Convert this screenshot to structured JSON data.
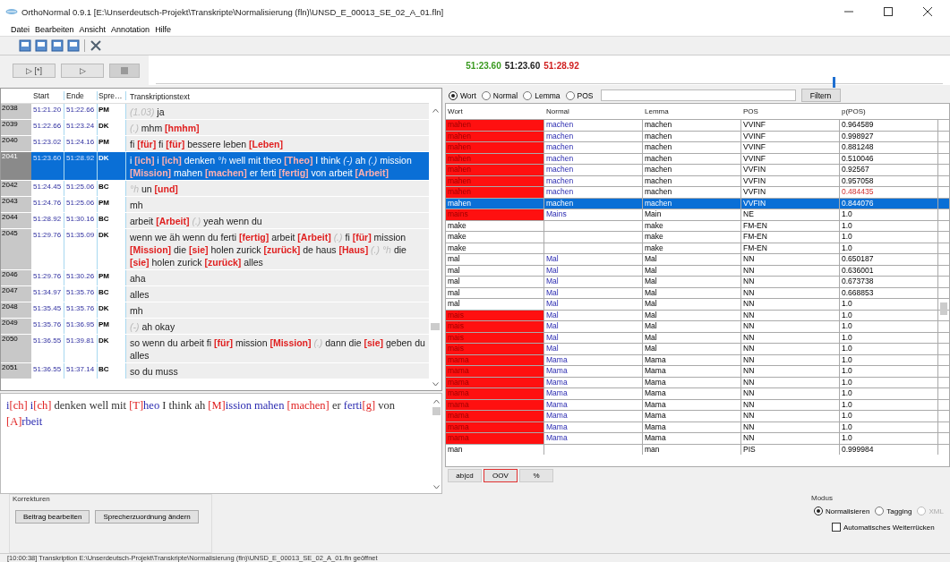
{
  "window": {
    "title": "OrthoNormal 0.9.1 [E:\\Unserdeutsch-Projekt\\Transkripte\\Normalisierung (fln)\\UNSD_E_00013_SE_02_A_01.fln]"
  },
  "menu": [
    "Datei",
    "Bearbeiten",
    "Ansicht",
    "Annotation",
    "Hilfe"
  ],
  "player": {
    "buttons": [
      {
        "label": "▷ [*]",
        "disabled": false
      },
      {
        "label": "▷",
        "disabled": false
      },
      {
        "kind": "stop",
        "disabled": true
      }
    ],
    "times": [
      {
        "text": "51:23.60",
        "color": "#3a9a20"
      },
      {
        "text": "51:23.60",
        "color": "#202020"
      },
      {
        "text": "51:28.92",
        "color": "#d02020"
      }
    ],
    "level": 0.86
  },
  "transcript": {
    "columns": [
      "Start",
      "Ende",
      "Spre…",
      "Transkriptionstext"
    ],
    "rows": [
      {
        "num": "2038",
        "start": "51:21.20",
        "end": "51:22.66",
        "speaker": "PM",
        "selected": false,
        "text": [
          {
            "t": "(1.03)",
            "kind": "pause"
          },
          {
            "t": "ja",
            "kind": "plain"
          }
        ]
      },
      {
        "num": "2039",
        "start": "51:22.66",
        "end": "51:23.24",
        "speaker": "DK",
        "selected": false,
        "text": [
          {
            "t": "(.)",
            "kind": "pause"
          },
          {
            "t": "mhm",
            "kind": "plain"
          },
          {
            "t": "[hmhm]",
            "kind": "norm"
          }
        ]
      },
      {
        "num": "2040",
        "start": "51:23.02",
        "end": "51:24.16",
        "speaker": "PM",
        "selected": false,
        "text": [
          {
            "t": "fi",
            "kind": "plain"
          },
          {
            "t": "[für]",
            "kind": "norm"
          },
          {
            "t": "fi",
            "kind": "plain"
          },
          {
            "t": "[für]",
            "kind": "norm"
          },
          {
            "t": "bessere leben",
            "kind": "plain"
          },
          {
            "t": "[Leben]",
            "kind": "norm"
          }
        ]
      },
      {
        "num": "2041",
        "start": "51:23.60",
        "end": "51:28.92",
        "speaker": "DK",
        "selected": true,
        "text": [
          {
            "t": "i",
            "kind": "plain"
          },
          {
            "t": "[ich]",
            "kind": "norm"
          },
          {
            "t": "i",
            "kind": "plain"
          },
          {
            "t": "[ich]",
            "kind": "norm"
          },
          {
            "t": "denken",
            "kind": "plain"
          },
          {
            "t": "°h",
            "kind": "pause"
          },
          {
            "t": "well mit theo",
            "kind": "plain"
          },
          {
            "t": "[Theo]",
            "kind": "norm"
          },
          {
            "t": "I think",
            "kind": "plain"
          },
          {
            "t": "(-)",
            "kind": "pause"
          },
          {
            "t": "ah",
            "kind": "plain"
          },
          {
            "t": "(.)",
            "kind": "pause"
          },
          {
            "t": "mission",
            "kind": "plain"
          },
          {
            "t": "[Mission]",
            "kind": "norm"
          },
          {
            "t": "mahen",
            "kind": "plain"
          },
          {
            "t": "[machen]",
            "kind": "norm"
          },
          {
            "t": "er ferti",
            "kind": "plain"
          },
          {
            "t": "[fertig]",
            "kind": "norm"
          },
          {
            "t": "von arbeit",
            "kind": "plain"
          },
          {
            "t": "[Arbeit]",
            "kind": "norm"
          }
        ]
      },
      {
        "num": "2042",
        "start": "51:24.45",
        "end": "51:25.06",
        "speaker": "BC",
        "selected": false,
        "text": [
          {
            "t": "°h",
            "kind": "pause"
          },
          {
            "t": "un",
            "kind": "plain"
          },
          {
            "t": "[und]",
            "kind": "norm"
          }
        ]
      },
      {
        "num": "2043",
        "start": "51:24.76",
        "end": "51:25.06",
        "speaker": "PM",
        "selected": false,
        "text": [
          {
            "t": "mh",
            "kind": "plain"
          }
        ]
      },
      {
        "num": "2044",
        "start": "51:28.92",
        "end": "51:30.16",
        "speaker": "BC",
        "selected": false,
        "text": [
          {
            "t": "arbeit",
            "kind": "plain"
          },
          {
            "t": "[Arbeit]",
            "kind": "norm"
          },
          {
            "t": "(.)",
            "kind": "pause"
          },
          {
            "t": "yeah wenn du",
            "kind": "plain"
          }
        ]
      },
      {
        "num": "2045",
        "start": "51:29.76",
        "end": "51:35.09",
        "speaker": "DK",
        "selected": false,
        "text": [
          {
            "t": "wenn we äh wenn du ferti",
            "kind": "plain"
          },
          {
            "t": "[fertig]",
            "kind": "norm"
          },
          {
            "t": "arbeit",
            "kind": "plain"
          },
          {
            "t": "[Arbeit]",
            "kind": "norm"
          },
          {
            "t": "(.)",
            "kind": "pause"
          },
          {
            "t": "fi",
            "kind": "plain"
          },
          {
            "t": "[für]",
            "kind": "norm"
          },
          {
            "t": "mission",
            "kind": "plain"
          },
          {
            "t": "[Mission]",
            "kind": "norm"
          },
          {
            "t": "die",
            "kind": "plain"
          },
          {
            "t": "[sie]",
            "kind": "norm"
          },
          {
            "t": "holen zurick",
            "kind": "plain"
          },
          {
            "t": "[zurück]",
            "kind": "norm"
          },
          {
            "t": "de haus",
            "kind": "plain"
          },
          {
            "t": "[Haus]",
            "kind": "norm"
          },
          {
            "t": "(.)",
            "kind": "pause"
          },
          {
            "t": "°h",
            "kind": "pause"
          },
          {
            "t": "die",
            "kind": "plain"
          },
          {
            "t": "[sie]",
            "kind": "norm"
          },
          {
            "t": "holen zurick",
            "kind": "plain"
          },
          {
            "t": "[zurück]",
            "kind": "norm"
          },
          {
            "t": "alles",
            "kind": "plain"
          }
        ]
      },
      {
        "num": "2046",
        "start": "51:29.76",
        "end": "51:30.26",
        "speaker": "PM",
        "selected": false,
        "text": [
          {
            "t": "aha",
            "kind": "plain"
          }
        ]
      },
      {
        "num": "2047",
        "start": "51:34.97",
        "end": "51:35.76",
        "speaker": "BC",
        "selected": false,
        "text": [
          {
            "t": "alles",
            "kind": "plain"
          }
        ]
      },
      {
        "num": "2048",
        "start": "51:35.45",
        "end": "51:35.76",
        "speaker": "DK",
        "selected": false,
        "text": [
          {
            "t": "mh",
            "kind": "plain"
          }
        ]
      },
      {
        "num": "2049",
        "start": "51:35.76",
        "end": "51:36.95",
        "speaker": "PM",
        "selected": false,
        "text": [
          {
            "t": "(-)",
            "kind": "pause"
          },
          {
            "t": "ah okay",
            "kind": "plain"
          }
        ]
      },
      {
        "num": "2050",
        "start": "51:36.55",
        "end": "51:39.81",
        "speaker": "DK",
        "selected": false,
        "text": [
          {
            "t": "so wenn du arbeit fi",
            "kind": "plain"
          },
          {
            "t": "[für]",
            "kind": "norm"
          },
          {
            "t": "mission",
            "kind": "plain"
          },
          {
            "t": "[Mission]",
            "kind": "norm"
          },
          {
            "t": "(.)",
            "kind": "pause"
          },
          {
            "t": "dann die",
            "kind": "plain"
          },
          {
            "t": "[sie]",
            "kind": "norm"
          },
          {
            "t": "geben du alles",
            "kind": "plain"
          }
        ]
      },
      {
        "num": "2051",
        "start": "51:36.55",
        "end": "51:37.14",
        "speaker": "BC",
        "selected": false,
        "text": [
          {
            "t": "so du muss",
            "kind": "plain"
          }
        ]
      }
    ]
  },
  "editor": [
    {
      "t": "i",
      "kind": "word"
    },
    {
      "t": "[ch] ",
      "kind": "fix"
    },
    {
      "t": "i",
      "kind": "word"
    },
    {
      "t": "[ch]",
      "kind": "fix"
    },
    {
      "t": " denken well mit ",
      "kind": "plain"
    },
    {
      "t": "[T]",
      "kind": "fix"
    },
    {
      "t": "heo",
      "kind": "word"
    },
    {
      "t": " I think ah ",
      "kind": "plain"
    },
    {
      "t": "[M]",
      "kind": "fix"
    },
    {
      "t": "ission mahen ",
      "kind": "word"
    },
    {
      "t": "[machen]",
      "kind": "fix"
    },
    {
      "t": " er ",
      "kind": "plain"
    },
    {
      "t": "ferti",
      "kind": "word"
    },
    {
      "t": "[g]",
      "kind": "fix"
    },
    {
      "t": " von ",
      "kind": "plain"
    },
    {
      "t": "[A]",
      "kind": "fix"
    },
    {
      "t": "rbeit",
      "kind": "word"
    }
  ],
  "filter": {
    "options": [
      {
        "label": "Wort",
        "selected": true
      },
      {
        "label": "Normal",
        "selected": false
      },
      {
        "label": "Lemma",
        "selected": false
      },
      {
        "label": "POS",
        "selected": false
      }
    ],
    "button": "Filtern"
  },
  "tokens": {
    "columns": [
      "Wort",
      "Normal",
      "Lemma",
      "POS",
      "p(POS)"
    ],
    "rows": [
      {
        "wort": "mahen",
        "normal": "machen",
        "lemma": "machen",
        "pos": "VVINF",
        "p": "0.964589",
        "oov": true,
        "low": false,
        "selected": false
      },
      {
        "wort": "mahen",
        "normal": "machen",
        "lemma": "machen",
        "pos": "VVINF",
        "p": "0.998927",
        "oov": true,
        "low": false,
        "selected": false
      },
      {
        "wort": "mahen",
        "normal": "machen",
        "lemma": "machen",
        "pos": "VVINF",
        "p": "0.881248",
        "oov": true,
        "low": false,
        "selected": false
      },
      {
        "wort": "mahen",
        "normal": "machen",
        "lemma": "machen",
        "pos": "VVINF",
        "p": "0.510046",
        "oov": true,
        "low": false,
        "selected": false
      },
      {
        "wort": "mahen",
        "normal": "machen",
        "lemma": "machen",
        "pos": "VVFIN",
        "p": "0.92567",
        "oov": true,
        "low": false,
        "selected": false
      },
      {
        "wort": "mahen",
        "normal": "machen",
        "lemma": "machen",
        "pos": "VVFIN",
        "p": "0.957058",
        "oov": true,
        "low": false,
        "selected": false
      },
      {
        "wort": "mahen",
        "normal": "machen",
        "lemma": "machen",
        "pos": "VVFIN",
        "p": "0.484435",
        "oov": true,
        "low": true,
        "selected": false
      },
      {
        "wort": "mahen",
        "normal": "machen",
        "lemma": "machen",
        "pos": "VVFIN",
        "p": "0.844076",
        "oov": true,
        "low": false,
        "selected": true
      },
      {
        "wort": "mains",
        "normal": "Mains",
        "lemma": "Main",
        "pos": "NE",
        "p": "1.0",
        "oov": true,
        "low": false,
        "selected": false
      },
      {
        "wort": "make",
        "lemma": "make",
        "pos": "FM-EN",
        "p": "1.0",
        "oov": false,
        "low": false,
        "selected": false
      },
      {
        "wort": "make",
        "lemma": "make",
        "pos": "FM-EN",
        "p": "1.0",
        "oov": false,
        "low": false,
        "selected": false
      },
      {
        "wort": "make",
        "lemma": "make",
        "pos": "FM-EN",
        "p": "1.0",
        "oov": false,
        "low": false,
        "selected": false
      },
      {
        "wort": "mal",
        "normal": "Mal",
        "lemma": "Mal",
        "pos": "NN",
        "p": "0.650187",
        "oov": false,
        "low": false,
        "selected": false
      },
      {
        "wort": "mal",
        "normal": "Mal",
        "lemma": "Mal",
        "pos": "NN",
        "p": "0.636001",
        "oov": false,
        "low": false,
        "selected": false
      },
      {
        "wort": "mal",
        "normal": "Mal",
        "lemma": "Mal",
        "pos": "NN",
        "p": "0.673738",
        "oov": false,
        "low": false,
        "selected": false
      },
      {
        "wort": "mal",
        "normal": "Mal",
        "lemma": "Mal",
        "pos": "NN",
        "p": "0.668853",
        "oov": false,
        "low": false,
        "selected": false
      },
      {
        "wort": "mal",
        "normal": "Mal",
        "lemma": "Mal",
        "pos": "NN",
        "p": "1.0",
        "oov": false,
        "low": false,
        "selected": false
      },
      {
        "wort": "mais",
        "normal": "Mal",
        "lemma": "Mal",
        "pos": "NN",
        "p": "1.0",
        "oov": true,
        "low": false,
        "selected": false
      },
      {
        "wort": "mais",
        "normal": "Mal",
        "lemma": "Mal",
        "pos": "NN",
        "p": "1.0",
        "oov": true,
        "low": false,
        "selected": false
      },
      {
        "wort": "mais",
        "normal": "Mal",
        "lemma": "Mal",
        "pos": "NN",
        "p": "1.0",
        "oov": true,
        "low": false,
        "selected": false
      },
      {
        "wort": "mais",
        "normal": "Mal",
        "lemma": "Mal",
        "pos": "NN",
        "p": "1.0",
        "oov": true,
        "low": false,
        "selected": false
      },
      {
        "wort": "mama",
        "normal": "Mama",
        "lemma": "Mama",
        "pos": "NN",
        "p": "1.0",
        "oov": true,
        "low": false,
        "selected": false
      },
      {
        "wort": "mama",
        "normal": "Mama",
        "lemma": "Mama",
        "pos": "NN",
        "p": "1.0",
        "oov": true,
        "low": false,
        "selected": false
      },
      {
        "wort": "mama",
        "normal": "Mama",
        "lemma": "Mama",
        "pos": "NN",
        "p": "1.0",
        "oov": true,
        "low": false,
        "selected": false
      },
      {
        "wort": "mama",
        "normal": "Mama",
        "lemma": "Mama",
        "pos": "NN",
        "p": "1.0",
        "oov": true,
        "low": false,
        "selected": false
      },
      {
        "wort": "mama",
        "normal": "Mama",
        "lemma": "Mama",
        "pos": "NN",
        "p": "1.0",
        "oov": true,
        "low": false,
        "selected": false
      },
      {
        "wort": "mama",
        "normal": "Mama",
        "lemma": "Mama",
        "pos": "NN",
        "p": "1.0",
        "oov": true,
        "low": false,
        "selected": false
      },
      {
        "wort": "mama",
        "normal": "Mama",
        "lemma": "Mama",
        "pos": "NN",
        "p": "1.0",
        "oov": true,
        "low": false,
        "selected": false
      },
      {
        "wort": "mama",
        "normal": "Mama",
        "lemma": "Mama",
        "pos": "NN",
        "p": "1.0",
        "oov": true,
        "low": false,
        "selected": false
      },
      {
        "wort": "man",
        "lemma": "man",
        "pos": "PIS",
        "p": "0.999984",
        "oov": false,
        "low": false,
        "selected": false
      }
    ]
  },
  "view_tabs": [
    {
      "label": "ab|cd",
      "selected": false
    },
    {
      "label": "OOV",
      "selected": true
    },
    {
      "label": "%",
      "selected": false
    }
  ],
  "corrections": {
    "title": "Korrekturen",
    "buttons": [
      "Beitrag bearbeiten",
      "Sprecherzuordnung ändern"
    ]
  },
  "mode": {
    "title": "Modus",
    "options": [
      {
        "label": "Normalisieren",
        "selected": true,
        "disabled": false
      },
      {
        "label": "Tagging",
        "selected": false,
        "disabled": false
      },
      {
        "label": "XML",
        "selected": false,
        "disabled": true
      }
    ],
    "auto_advance": {
      "label": "Automatisches Weiterrücken",
      "checked": false
    }
  },
  "status_bar": "[10:00:38] Transkription E:\\Unserdeutsch-Projekt\\Transkripte\\Normalisierung (fln)\\UNSD_E_00013_SE_02_A_01.fln geöffnet"
}
